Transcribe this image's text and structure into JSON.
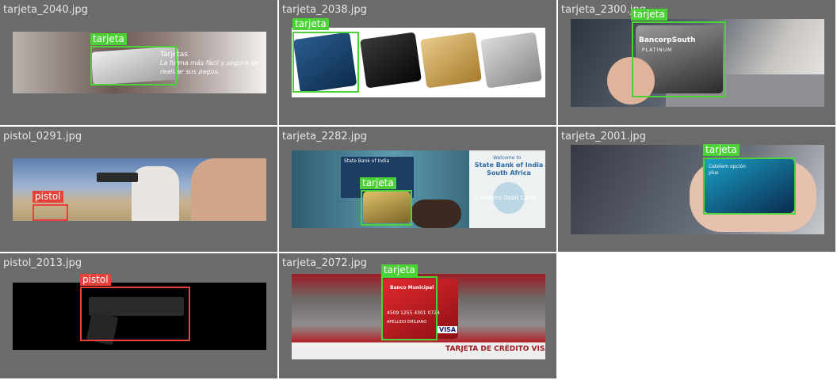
{
  "tiles": [
    {
      "filename": "tarjeta_2040.jpg",
      "label": "tarjeta",
      "overlay_title": "Tarjetas",
      "overlay_text": "La forma más fácil y segura de realizar sus pagos."
    },
    {
      "filename": "tarjeta_2038.jpg",
      "label": "tarjeta"
    },
    {
      "filename": "tarjeta_2300.jpg",
      "label": "tarjeta",
      "card_brand": "BancorpSouth",
      "card_tier": "PLATINUM"
    },
    {
      "filename": "pistol_0291.jpg",
      "label": "pistol"
    },
    {
      "filename": "tarjeta_2282.jpg",
      "label": "tarjeta",
      "atm_header": "State Bank of India",
      "banner_welcome": "Welcome to",
      "banner_title": "State Bank of India South Africa",
      "banner_sub": "A Maestro Debit Cards"
    },
    {
      "filename": "tarjeta_2001.jpg",
      "label": "tarjeta",
      "card_text": "Cetelem opción plus"
    },
    {
      "filename": "pistol_2013.jpg",
      "label": "pistol"
    },
    {
      "filename": "tarjeta_2072.jpg",
      "label": "tarjeta",
      "card_bank": "Banco Municipal",
      "card_number": "4509 1255 4301 0724",
      "card_holder": "APELLIDO EMILIANO",
      "card_network": "VISA",
      "banner_caption": "TARJETA DE CRÉDITO VISA"
    }
  ],
  "colors": {
    "tile_bg": "#6b6b6b",
    "box_tarjeta": "#4cd137",
    "box_pistol": "#e8413a"
  }
}
